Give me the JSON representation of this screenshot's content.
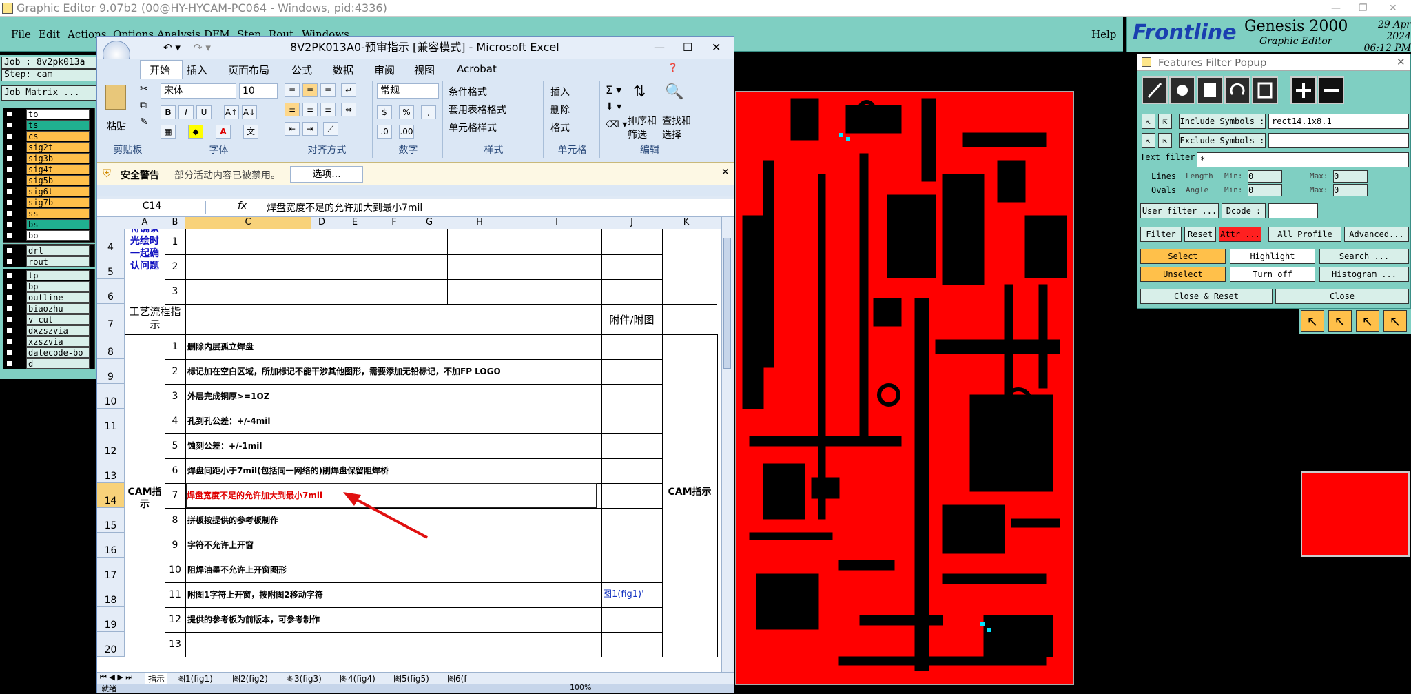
{
  "genesis": {
    "title": "Graphic Editor 9.07b2 (00@HY-HYCAM-PC064 - Windows, pid:4336)",
    "menu": [
      "File",
      "Edit",
      "Actions",
      "Options",
      "Analysis",
      "DFM",
      "Step",
      "Rout",
      "Windows",
      "Help"
    ],
    "brand": "Frontline",
    "product": "Genesis 2000",
    "subtitle": "Graphic Editor",
    "date": "29 Apr 2024",
    "time": "06:12 PM",
    "job": "Job : 8v2pk013a",
    "step": "Step: cam",
    "matrix_btn": "Job Matrix ...",
    "layers_a": [
      {
        "name": "to",
        "color": "#ffffff"
      },
      {
        "name": "ts",
        "color": "#20b090"
      },
      {
        "name": "cs",
        "color": "#ffc04a"
      },
      {
        "name": "sig2t",
        "color": "#ffc04a"
      },
      {
        "name": "sig3b",
        "color": "#ffc04a"
      },
      {
        "name": "sig4t",
        "color": "#ffc04a"
      },
      {
        "name": "sig5b",
        "color": "#ffc04a"
      },
      {
        "name": "sig6t",
        "color": "#ffc04a"
      },
      {
        "name": "sig7b",
        "color": "#ffc04a"
      },
      {
        "name": "ss",
        "color": "#ffc04a"
      },
      {
        "name": "bs",
        "color": "#20b090"
      },
      {
        "name": "bo",
        "color": "#ffffff"
      }
    ],
    "layers_b": [
      {
        "name": "drl",
        "color": "#d8efe9"
      },
      {
        "name": "rout",
        "color": "#d8efe9"
      }
    ],
    "layers_c": [
      {
        "name": "tp",
        "color": "#d8efe9"
      },
      {
        "name": "bp",
        "color": "#d8efe9"
      },
      {
        "name": "outline",
        "color": "#d8efe9"
      },
      {
        "name": "biaozhu",
        "color": "#d8efe9"
      },
      {
        "name": "v-cut",
        "color": "#d8efe9"
      },
      {
        "name": "dxzszvia",
        "color": "#d8efe9"
      },
      {
        "name": "xzszvia",
        "color": "#d8efe9"
      },
      {
        "name": "datecode-bo",
        "color": "#d8efe9"
      },
      {
        "name": "d",
        "color": "#d8efe9"
      }
    ]
  },
  "excel": {
    "title": "8V2PK013A0-预审指示  [兼容模式] - Microsoft Excel",
    "tabs": [
      "开始",
      "插入",
      "页面布局",
      "公式",
      "数据",
      "审阅",
      "视图",
      "Acrobat"
    ],
    "groups": {
      "clipboard": "剪贴板",
      "paste": "粘贴",
      "font": "字体",
      "font_name": "宋体",
      "font_size": "10",
      "align": "对齐方式",
      "number": "数字",
      "number_format": "常规",
      "styles": "样式",
      "cond": "条件格式",
      "table": "套用表格格式",
      "cellstyle": "单元格样式",
      "cells": "单元格",
      "insert": "插入",
      "delete": "删除",
      "format": "格式",
      "edit": "编辑",
      "sort": "排序和",
      "filter": "筛选",
      "find": "查找和",
      "select": "选择"
    },
    "security": {
      "label": "安全警告",
      "msg": "部分活动内容已被禁用。",
      "btn": "选项..."
    },
    "namebox": "C14",
    "formula": "焊盘宽度不足的允许加大到最小7mil",
    "cols": [
      "A",
      "B",
      "C",
      "D",
      "E",
      "F",
      "G",
      "H",
      "I",
      "J",
      "K"
    ],
    "rows": [
      "4",
      "5",
      "6",
      "7",
      "8",
      "9",
      "10",
      "11",
      "12",
      "13",
      "14",
      "15",
      "16",
      "17",
      "18",
      "19",
      "20"
    ],
    "confirm_label": "待确认光绘时一起确认问题",
    "process_label": "工艺流程指示",
    "attach_label": "附件/附图",
    "cam_label": "CAM指示",
    "top_nums": [
      "1",
      "2",
      "3"
    ],
    "items": [
      {
        "n": "1",
        "text": "删除内层孤立焊盘"
      },
      {
        "n": "2",
        "text": "标记加在空白区域，所加标记不能干涉其他图形，需要添加无铅标记，不加FP LOGO"
      },
      {
        "n": "3",
        "text": "外层完成铜厚>=1OZ"
      },
      {
        "n": "4",
        "text": "孔到孔公差：+/-4mil"
      },
      {
        "n": "5",
        "text": "蚀刻公差：+/-1mil"
      },
      {
        "n": "6",
        "text": "焊盘间距小于7mil(包括同一网络的)削焊盘保留阻焊桥"
      },
      {
        "n": "7",
        "text": "焊盘宽度不足的允许加大到最小7mil"
      },
      {
        "n": "8",
        "text": "拼板按提供的参考板制作"
      },
      {
        "n": "9",
        "text": "字符不允许上开窗"
      },
      {
        "n": "10",
        "text": "阻焊油墨不允许上开窗图形"
      },
      {
        "n": "11",
        "text": "附图1字符上开窗，按附图2移动字符"
      },
      {
        "n": "12",
        "text": "提供的参考板为前版本，可参考制作"
      },
      {
        "n": "13",
        "text": ""
      }
    ],
    "link": "图1(fig1)'",
    "sheets": [
      "指示",
      "图1(fig1)",
      "图2(fig2)",
      "图3(fig3)",
      "图4(fig4)",
      "图5(fig5)",
      "图6(f"
    ],
    "status": "就绪",
    "zoom": "100%"
  },
  "filter": {
    "title": "Features Filter Popup",
    "include_label": "Include Symbols :",
    "include_value": "rect14.1x8.1",
    "exclude_label": "Exclude Symbols :",
    "exclude_value": "",
    "text_filter": "Text filter",
    "text_value": "*",
    "lines": "Lines",
    "ovals": "Ovals",
    "length": "Length",
    "angle": "Angle",
    "min": "Min:",
    "max": "Max:",
    "zero": "0",
    "user_filter": "User filter ...",
    "dcode": "Dcode :",
    "filter_btn": "Filter",
    "reset": "Reset",
    "attr": "Attr ...",
    "profile": "All Profile",
    "advanced": "Advanced...",
    "select": "Select",
    "highlight": "Highlight",
    "search": "Search ...",
    "unselect": "Unselect",
    "turnoff": "Turn off",
    "histogram": "Histogram ...",
    "close_reset": "Close & Reset",
    "close": "Close"
  }
}
